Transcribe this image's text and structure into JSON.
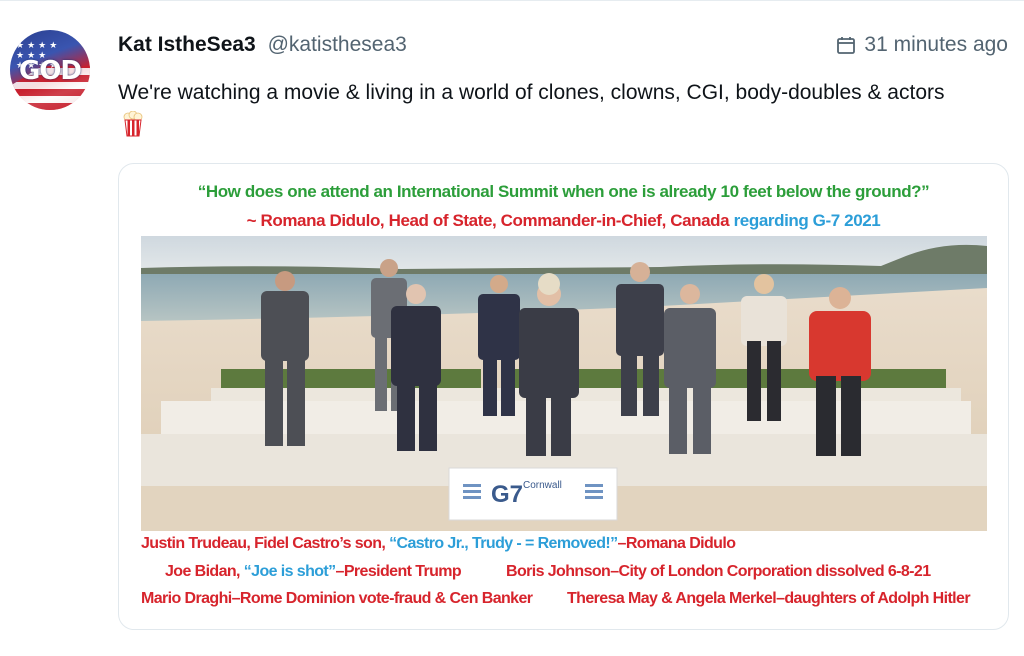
{
  "tweet": {
    "display_name": "Kat IstheSea3",
    "handle": "@katisthesea3",
    "timestamp": "31 minutes ago",
    "text": "We're watching a movie & living in a world of clones, clowns, CGI, body-doubles & actors",
    "emoji_icon": "popcorn-icon",
    "avatar_text": "GOD"
  },
  "media": {
    "quote_line_1": "“How does one attend an International Summit when one is already 10 feet below the ground?”",
    "quote_line_2_red": "~ Romana Didulo, Head of State, Commander-in-Chief, Canada ",
    "quote_line_2_blue": "regarding G-7 2021",
    "sign_text": "G7",
    "sign_sub": "Cornwall",
    "captions": {
      "c1_red_a": "Justin Trudeau, Fidel Castro’s son, ",
      "c1_blue": "“Castro Jr., Trudy - = Removed!”",
      "c1_red_b": "–Romana Didulo",
      "c2_red_a": "Joe Bidan, ",
      "c2_blue": "“Joe is shot”",
      "c2_red_b": "–President Trump",
      "c3": "Boris Johnson–City of London Corporation dissolved 6-8-21",
      "c4": "Mario Draghi–Rome Dominion vote-fraud & Cen Banker",
      "c5": "Theresa May & Angela Merkel–daughters of Adolph Hitler"
    }
  },
  "colors": {
    "quote_green": "#2c9e3a",
    "caption_red": "#d7242c",
    "caption_blue": "#2c9ed8",
    "muted": "#536471"
  }
}
